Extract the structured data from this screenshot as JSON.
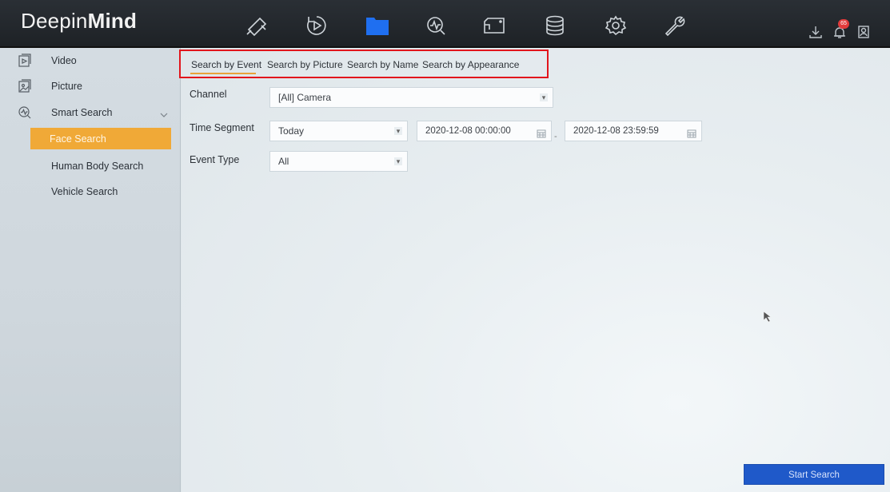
{
  "app": {
    "logo_part1": "Deepin",
    "logo_part2": "Mind"
  },
  "topnav": {
    "icons": [
      "camera-icon",
      "playback-icon",
      "folder-icon",
      "smart-analysis-icon",
      "screen-icon",
      "storage-icon",
      "settings-icon",
      "maintenance-icon"
    ],
    "active": "folder-icon",
    "right_icons": [
      "download-icon",
      "alarm-bell-icon",
      "user-icon"
    ],
    "alarm_badge": "65"
  },
  "sidebar": {
    "items": [
      {
        "label": "Video",
        "icon": "video-file-icon"
      },
      {
        "label": "Picture",
        "icon": "picture-file-icon"
      },
      {
        "label": "Smart Search",
        "icon": "smart-search-icon"
      },
      {
        "label": "Face Search"
      },
      {
        "label": "Human Body Search"
      },
      {
        "label": "Vehicle Search"
      }
    ],
    "selected": "Face Search"
  },
  "tabs": [
    {
      "label": "Search by Event"
    },
    {
      "label": "Search by Picture"
    },
    {
      "label": "Search by Name"
    },
    {
      "label": "Search by Appearance"
    }
  ],
  "active_tab": "Search by Event",
  "form": {
    "channel_label": "Channel",
    "channel_value": "[All] Camera",
    "time_segment_label": "Time Segment",
    "time_segment_value": "Today",
    "start_time": "2020-12-08 00:00:00",
    "range_separator": "-",
    "end_time": "2020-12-08 23:59:59",
    "event_type_label": "Event Type",
    "event_type_value": "All"
  },
  "start_button": "Start Search",
  "colors": {
    "accent": "#f0a937",
    "primary_button": "#1f59c9",
    "highlight_box": "#e2151c",
    "topbar": "#23282d"
  }
}
